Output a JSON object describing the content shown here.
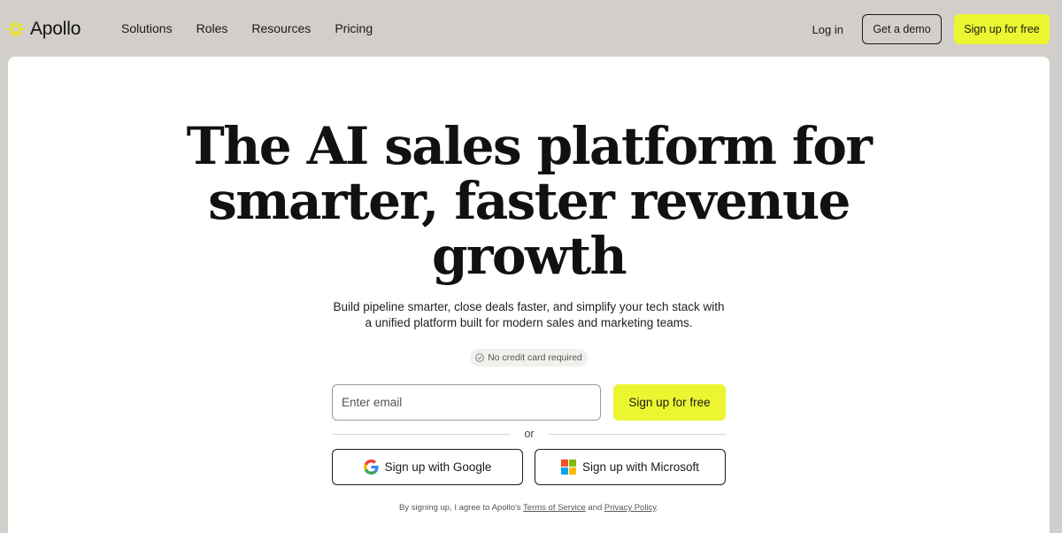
{
  "brand": {
    "name": "Apollo",
    "logo_icon": "apollo-sunburst-icon",
    "accent_color": "#ebf631"
  },
  "nav": {
    "links": [
      "Solutions",
      "Roles",
      "Resources",
      "Pricing"
    ],
    "login_label": "Log in",
    "demo_label": "Get a demo",
    "signup_label": "Sign up for free"
  },
  "hero": {
    "headline_lines": [
      "The AI sales platform for",
      "smarter, faster revenue",
      "growth"
    ],
    "subtext_lines": [
      "Build pipeline smarter, close deals faster, and simplify your tech stack with",
      "a unified platform built for modern sales and marketing teams."
    ],
    "badge": {
      "icon": "check-circle-icon",
      "label": "No credit card required"
    }
  },
  "signup_form": {
    "email_placeholder": "Enter email",
    "email_value": "",
    "submit_label": "Sign up for free",
    "or_label": "or",
    "google_label": "Sign up with Google",
    "google_icon": "google-icon",
    "microsoft_label": "Sign up with Microsoft",
    "microsoft_icon": "microsoft-icon"
  },
  "terms": {
    "prefix": "By signing up, I agree to Apollo's",
    "terms_link": "Terms of Service",
    "middle": "and",
    "privacy_link": "Privacy Policy",
    "suffix": "."
  }
}
